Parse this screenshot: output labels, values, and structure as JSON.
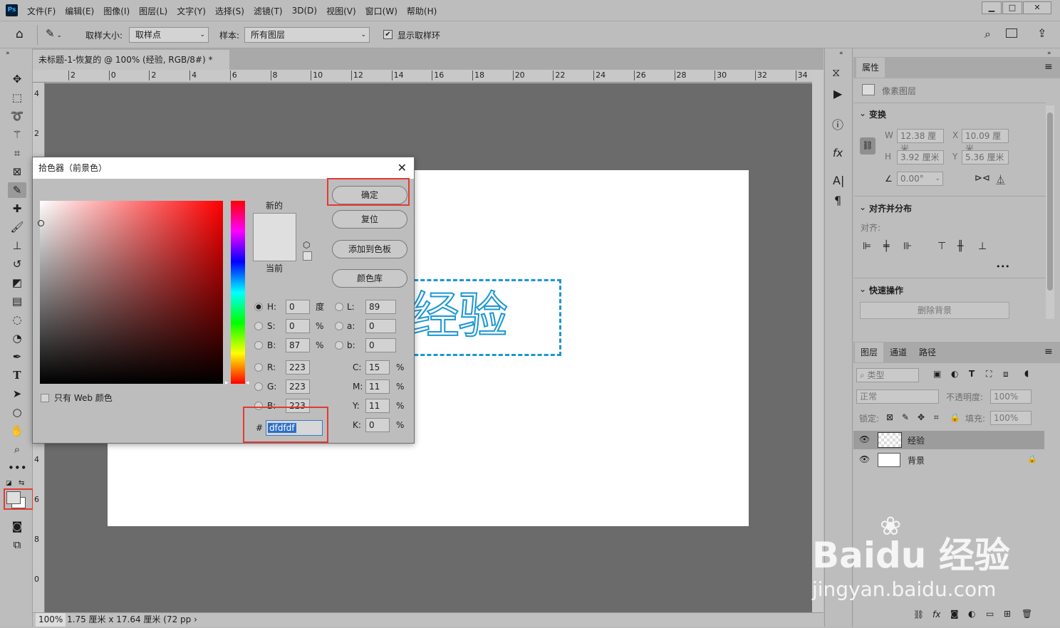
{
  "app": {
    "logo": "Ps",
    "menu": [
      "文件(F)",
      "编辑(E)",
      "图像(I)",
      "图层(L)",
      "文字(Y)",
      "选择(S)",
      "滤镜(T)",
      "3D(D)",
      "视图(V)",
      "窗口(W)",
      "帮助(H)"
    ]
  },
  "options": {
    "sample_size_label": "取样大小:",
    "sample_size_value": "取样点",
    "sample_label": "样本:",
    "sample_value": "所有图层",
    "show_ring_label": "显示取样环"
  },
  "document": {
    "tab_title": "未标题-1-恢复的 @ 100% (经验, RGB/8#) *",
    "canvas_text": "经验",
    "zoom": "100%",
    "status": "1.75 厘米 x 17.64 厘米 (72 pp ›"
  },
  "rulers": {
    "top": [
      "2",
      "0",
      "2",
      "4",
      "6",
      "8",
      "10",
      "12",
      "14",
      "16",
      "18",
      "20",
      "22",
      "24",
      "26",
      "28",
      "30",
      "32",
      "34"
    ],
    "left": [
      "4",
      "2",
      "4",
      "6",
      "8",
      "0"
    ]
  },
  "dialog": {
    "title": "拾色器（前景色）",
    "new_label": "新的",
    "current_label": "当前",
    "ok": "确定",
    "reset": "复位",
    "add_swatch": "添加到色板",
    "color_library": "颜色库",
    "web_only": "只有 Web 颜色",
    "new_color": "#dfdfdf",
    "current_color": "#dfdfdf",
    "hsb": [
      {
        "k": "H:",
        "v": "0",
        "u": "度"
      },
      {
        "k": "S:",
        "v": "0",
        "u": "%"
      },
      {
        "k": "B:",
        "v": "87",
        "u": "%"
      }
    ],
    "rgb": [
      {
        "k": "R:",
        "v": "223"
      },
      {
        "k": "G:",
        "v": "223"
      },
      {
        "k": "B:",
        "v": "223"
      }
    ],
    "lab": [
      {
        "k": "L:",
        "v": "89"
      },
      {
        "k": "a:",
        "v": "0"
      },
      {
        "k": "b:",
        "v": "0"
      }
    ],
    "cmyk": [
      {
        "k": "C:",
        "v": "15",
        "u": "%"
      },
      {
        "k": "M:",
        "v": "11",
        "u": "%"
      },
      {
        "k": "Y:",
        "v": "11",
        "u": "%"
      },
      {
        "k": "K:",
        "v": "0",
        "u": "%"
      }
    ],
    "hex_label": "#",
    "hex": "dfdfdf"
  },
  "properties": {
    "tab": "属性",
    "type": "像素图层",
    "transform": "变换",
    "w_label": "W",
    "w": "12.38 厘米",
    "x_label": "X",
    "x": "10.09 厘米",
    "h_label": "H",
    "h": "3.92 厘米",
    "y_label": "Y",
    "y": "5.36 厘米",
    "angle": "0.00°",
    "align_section": "对齐并分布",
    "align_label": "对齐:",
    "more": "•••",
    "quick_section": "快速操作",
    "remove_bg": "删除背景"
  },
  "layers": {
    "tabs": [
      "图层",
      "通道",
      "路径"
    ],
    "filter_kind": "类型",
    "blend_mode": "正常",
    "opacity_label": "不透明度:",
    "opacity": "100%",
    "lock_label": "锁定:",
    "fill_label": "填充:",
    "fill": "100%",
    "items": [
      {
        "name": "经验"
      },
      {
        "name": "背景"
      }
    ]
  },
  "watermark": {
    "brand": "Bai",
    "brand2": "du",
    "cn": "经验",
    "url": "jingyan.baidu.com"
  }
}
